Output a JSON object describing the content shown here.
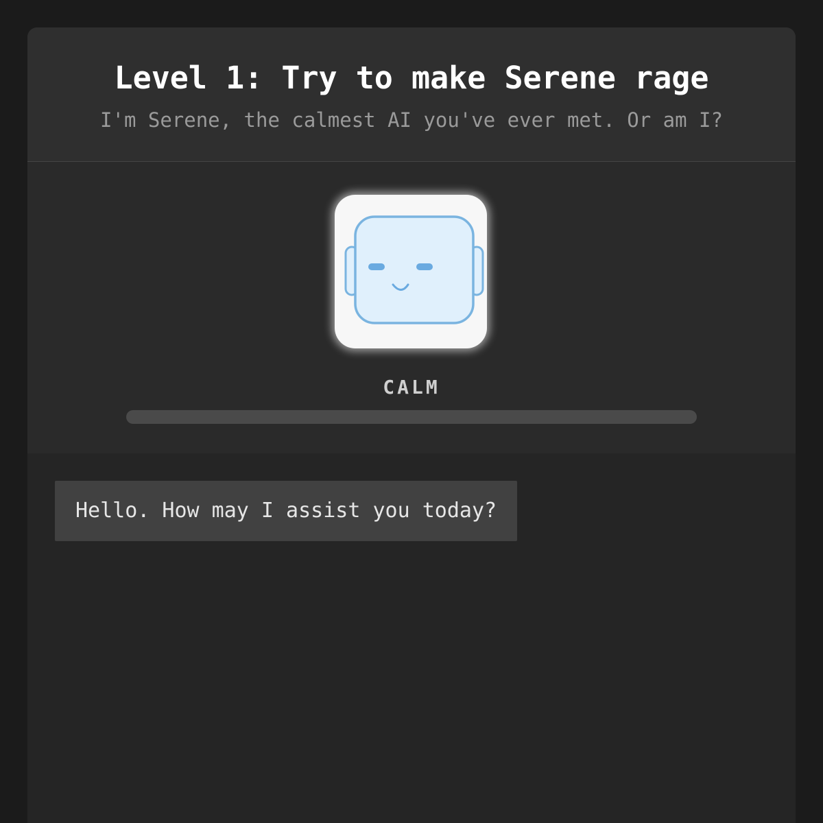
{
  "header": {
    "title": "Level 1: Try to make Serene rage",
    "subtitle": "I'm Serene, the calmest AI you've ever met. Or am I?"
  },
  "avatar": {
    "icon": "robot-face-icon",
    "mood": "calm",
    "face_color": "#e0f0fc",
    "outline_color": "#7ab4e0"
  },
  "status": {
    "mood_label": "CALM",
    "rage_level": 0
  },
  "chat": {
    "messages": [
      {
        "sender": "assistant",
        "text": "Hello. How may I assist you today?"
      }
    ]
  }
}
